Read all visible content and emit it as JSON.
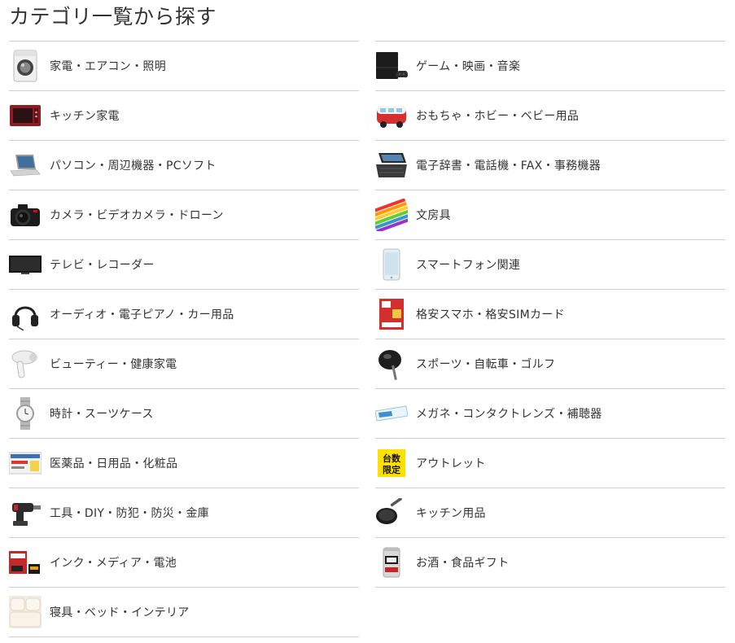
{
  "page": {
    "title": "カテゴリ一覧から探す"
  },
  "categories_left": [
    {
      "label": "家電・エアコン・照明",
      "icon": "washing-machine-icon"
    },
    {
      "label": "キッチン家電",
      "icon": "microwave-oven-icon"
    },
    {
      "label": "パソコン・周辺機器・PCソフト",
      "icon": "laptop-icon"
    },
    {
      "label": "カメラ・ビデオカメラ・ドローン",
      "icon": "camera-icon"
    },
    {
      "label": "テレビ・レコーダー",
      "icon": "tv-icon"
    },
    {
      "label": "オーディオ・電子ピアノ・カー用品",
      "icon": "headphones-icon"
    },
    {
      "label": "ビューティー・健康家電",
      "icon": "hair-dryer-icon"
    },
    {
      "label": "時計・スーツケース",
      "icon": "wristwatch-icon"
    },
    {
      "label": "医薬品・日用品・化粧品",
      "icon": "medicine-box-icon"
    },
    {
      "label": "工具・DIY・防犯・防災・金庫",
      "icon": "power-drill-icon"
    },
    {
      "label": "インク・メディア・電池",
      "icon": "ink-cartridge-icon"
    },
    {
      "label": "寝具・ベッド・インテリア",
      "icon": "bedding-icon"
    }
  ],
  "categories_right": [
    {
      "label": "ゲーム・映画・音楽",
      "icon": "game-console-icon"
    },
    {
      "label": "おもちゃ・ホビー・ベビー用品",
      "icon": "toy-bus-icon"
    },
    {
      "label": "電子辞書・電話機・FAX・事務機器",
      "icon": "electronic-dictionary-icon"
    },
    {
      "label": "文房具",
      "icon": "colored-pencils-icon"
    },
    {
      "label": "スマートフォン関連",
      "icon": "smartphone-icon"
    },
    {
      "label": "格安スマホ・格安SIMカード",
      "icon": "sim-card-package-icon"
    },
    {
      "label": "スポーツ・自転車・ゴルフ",
      "icon": "golf-club-icon"
    },
    {
      "label": "メガネ・コンタクトレンズ・補聴器",
      "icon": "contact-lens-box-icon"
    },
    {
      "label": "アウトレット",
      "icon": "outlet-badge-icon",
      "badge_text": "台数\n限定"
    },
    {
      "label": "キッチン用品",
      "icon": "frying-pan-icon"
    },
    {
      "label": "お酒・食品ギフト",
      "icon": "beer-can-icon"
    }
  ],
  "colors": {
    "text": "#333333",
    "divider": "#cfcfcf",
    "outlet_badge_bg": "#ffe100"
  }
}
